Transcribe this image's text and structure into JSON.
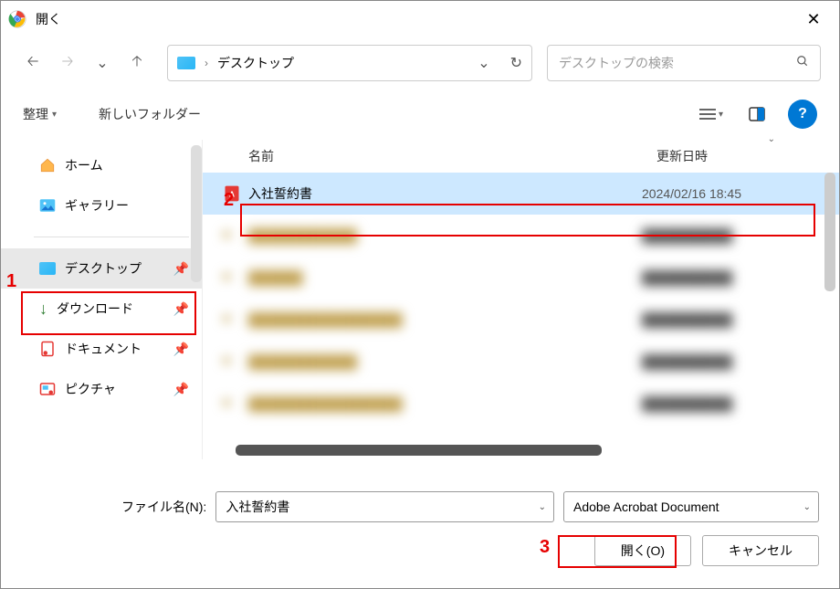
{
  "window": {
    "title": "開く"
  },
  "nav": {
    "location": "デスクトップ",
    "search_placeholder": "デスクトップの検索"
  },
  "toolbar": {
    "organize": "整理",
    "new_folder": "新しいフォルダー"
  },
  "sidebar": {
    "home": "ホーム",
    "gallery": "ギャラリー",
    "desktop": "デスクトップ",
    "downloads": "ダウンロード",
    "documents": "ドキュメント",
    "pictures": "ピクチャ"
  },
  "columns": {
    "name": "名前",
    "modified": "更新日時"
  },
  "files": {
    "selected": {
      "name": "入社誓約書",
      "date": "2024/02/16 18:45"
    },
    "blur1_name": "████████████",
    "blur1_date": "██████████",
    "blur2_name": "██████",
    "blur2_date": "██████████",
    "blur3_name": "█████████████████",
    "blur3_date": "██████████",
    "blur4_name": "████████████",
    "blur4_date": "██████████",
    "blur5_name": "█████████████████",
    "blur5_date": "██████████"
  },
  "footer": {
    "filename_label": "ファイル名(N):",
    "filename_value": "入社誓約書",
    "filter": "Adobe Acrobat Document",
    "open": "開く(O)",
    "cancel": "キャンセル"
  },
  "annotations": {
    "n1": "1",
    "n2": "2",
    "n3": "3"
  }
}
